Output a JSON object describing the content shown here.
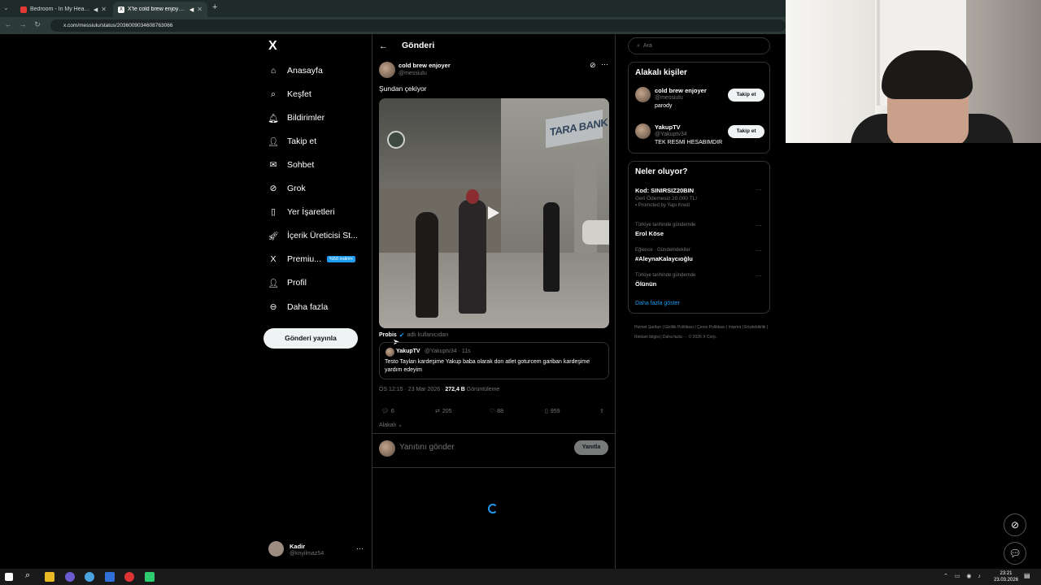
{
  "browser": {
    "tabs": [
      {
        "title": "Bedroom - In My Head (Of",
        "active": false,
        "favicon_color": "#e53935"
      },
      {
        "title": "X'te cold brew enjoyer: \"Şu",
        "active": true,
        "favicon_color": "#ffffff"
      }
    ],
    "new_tab": "+",
    "url": "x.com/messiulu/status/2036009034608763066"
  },
  "nav": {
    "logo": "X",
    "items": [
      {
        "label": "Anasayfa",
        "icon": "home-icon"
      },
      {
        "label": "Keşfet",
        "icon": "search-icon"
      },
      {
        "label": "Bildirimler",
        "icon": "bell-icon"
      },
      {
        "label": "Takip et",
        "icon": "add-person-icon"
      },
      {
        "label": "Sohbet",
        "icon": "mail-icon"
      },
      {
        "label": "Grok",
        "icon": "grok-icon"
      },
      {
        "label": "Yer İşaretleri",
        "icon": "bookmark-icon"
      },
      {
        "label": "İçerik Üreticisi St...",
        "icon": "rocket-icon"
      },
      {
        "label": "Premiu...",
        "icon": "x-icon",
        "badge": "%50 indirim"
      },
      {
        "label": "Profil",
        "icon": "person-icon"
      },
      {
        "label": "Daha fazla",
        "icon": "more-circle-icon"
      }
    ],
    "post_button": "Gönderi yayınla",
    "account": {
      "name": "Kadir",
      "handle": "@knyilmaz54",
      "more": "···"
    }
  },
  "post": {
    "header_title": "Gönderi",
    "author_name": "cold brew enjoyer",
    "author_handle": "@messiulu",
    "text": "Şundan çekiyor",
    "video_sign_text": "TARA BANK",
    "source_name": "Probis",
    "source_suffix": "adlı kullanıcıdan",
    "quote": {
      "name": "YakupTV",
      "meta": "@Yakuptv34 · 11s",
      "text": "Testo Taylan kardeşime Yakup baba olarak don atlet goturcem gariban kardeşime  yardım edeyim"
    },
    "time": "ÖS 12:15 · 23 Mar 2026 · ",
    "views": "272,4 B",
    "views_label": " Görüntüleme",
    "stats": {
      "replies": "6",
      "reposts": "205",
      "likes": "88",
      "bookmarks": "959"
    },
    "relevant_label": "Alakalı",
    "reply_placeholder": "Yanıtını gönder",
    "reply_button": "Yanıtla"
  },
  "sidebar": {
    "search_placeholder": "Ara",
    "relevant_title": "Alakalı kişiler",
    "people": [
      {
        "name": "cold brew enjoyer",
        "handle": "@messiulu",
        "bio": "parody",
        "follow": "Takip et"
      },
      {
        "name": "YakupTV",
        "handle": "@Yakuptv34",
        "bio": "TEK RESMİ HESABIMDIR",
        "follow": "Takip et"
      }
    ],
    "trends_title": "Neler oluyor?",
    "trends": [
      {
        "context": "",
        "name": "Kod: SINIRSIZ20BIN",
        "sub": "Geri Ödemesiz 20.000 TL!",
        "extra": "Promoted by Yapı Kredi"
      },
      {
        "context": "Türkiye tarihinde gündemde",
        "name": "Erol Köse",
        "sub": "",
        "extra": ""
      },
      {
        "context": "Eğlence · Gündemdekiler",
        "name": "#AleynaKalaycıoğlu",
        "sub": "",
        "extra": ""
      },
      {
        "context": "Türkiye tarihinde gündemde",
        "name": "Ölünün",
        "sub": "",
        "extra": ""
      }
    ],
    "show_more": "Daha fazla göster",
    "footer": "Hizmet Şartları  |  Gizlilik Politikası  |  Çerez Politikası  |  Imprint  |  Erişilebilirlik  |  Reklam bilgisi  |  Daha fazla ···  © 2026 X Corp."
  },
  "taskbar": {
    "time": "23:21",
    "date": "23.03.2026"
  }
}
